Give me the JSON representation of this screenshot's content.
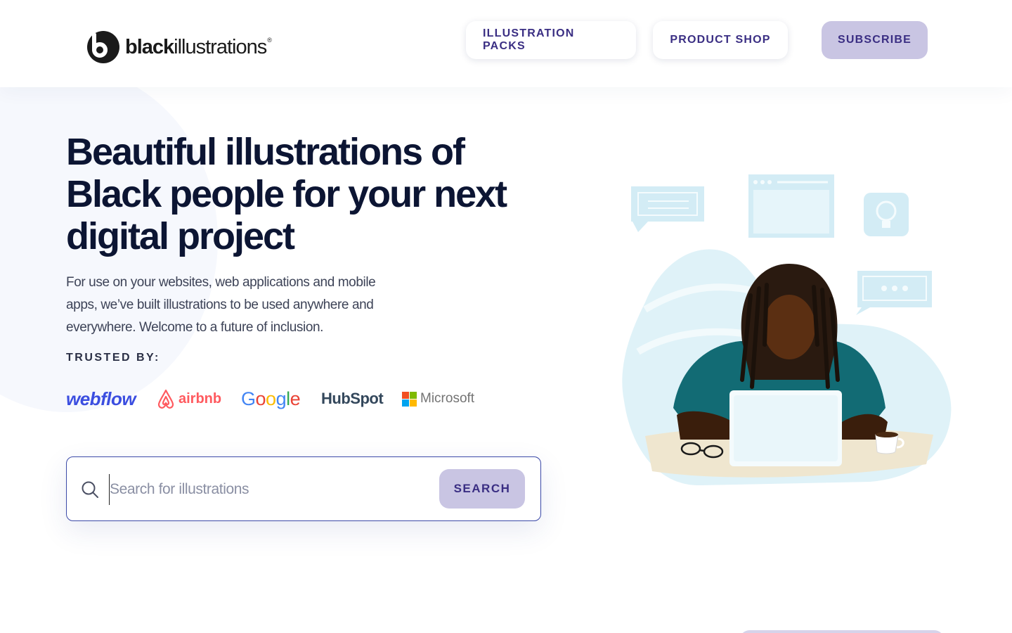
{
  "brand": {
    "logo_word_bold": "black",
    "logo_word_light": "illustrations",
    "logo_mark": "®"
  },
  "nav": {
    "packs_label": "ILLUSTRATION PACKS",
    "shop_label": "PRODUCT SHOP",
    "subscribe_label": "SUBSCRIBE"
  },
  "hero": {
    "title": "Beautiful illustrations of Black people for your next digital project",
    "description": "For use on your websites, web applications and mobile apps, we’ve built illustrations to be used anywhere and everywhere.  Welcome to a future of inclusion.",
    "trusted_label": "TRUSTED BY:"
  },
  "trusted_brands": {
    "webflow": "webflow",
    "airbnb": "airbnb",
    "google": "Google",
    "hubspot": "HubSpot",
    "microsoft": "Microsoft"
  },
  "search": {
    "placeholder": "Search for illustrations",
    "value": "",
    "button_label": "SEARCH"
  },
  "colors": {
    "accent": "#c9c5e3",
    "accent_text": "#3a2e83",
    "heading": "#0c1533",
    "search_border": "#3c4aa8"
  }
}
